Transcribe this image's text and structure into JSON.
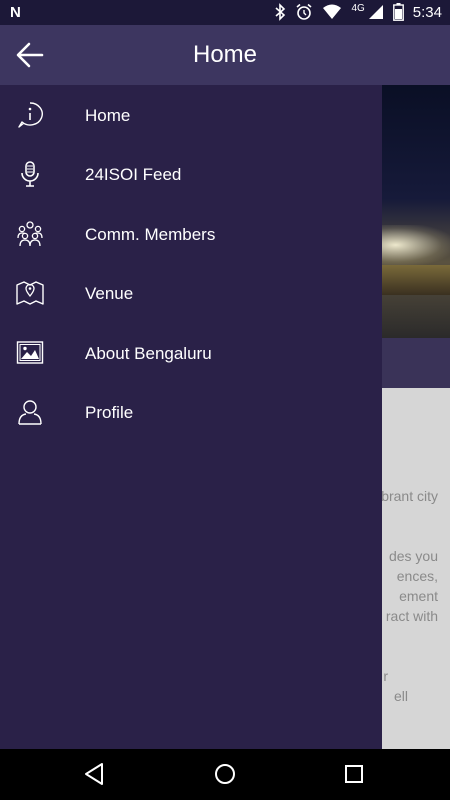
{
  "status_bar": {
    "notification_icon": "N",
    "network": "4G",
    "time": "5:34",
    "icons": [
      "bluetooth-icon",
      "alarm-icon",
      "wifi-icon",
      "cell-signal-icon",
      "battery-icon"
    ]
  },
  "app_bar": {
    "title": "Home",
    "back_icon": "arrow-left-icon"
  },
  "drawer": {
    "items": [
      {
        "label": "Home",
        "icon": "info-icon"
      },
      {
        "label": "24ISOI Feed",
        "icon": "microphone-icon"
      },
      {
        "label": "Comm. Members",
        "icon": "group-icon"
      },
      {
        "label": "Venue",
        "icon": "map-icon"
      },
      {
        "label": "About Bengaluru",
        "icon": "image-icon"
      },
      {
        "label": "Profile",
        "icon": "user-icon"
      }
    ]
  },
  "background_page": {
    "text_fragments": [
      "brant city",
      "des you",
      "ences,",
      "ement",
      "ract with",
      "r",
      "ell"
    ]
  },
  "nav_bar": {
    "buttons": [
      "back-triangle-icon",
      "home-circle-icon",
      "recents-square-icon"
    ]
  },
  "colors": {
    "status_bar": "#1c1838",
    "app_bar": "#3d3660",
    "drawer": "#2a2148",
    "text": "#ffffff"
  }
}
